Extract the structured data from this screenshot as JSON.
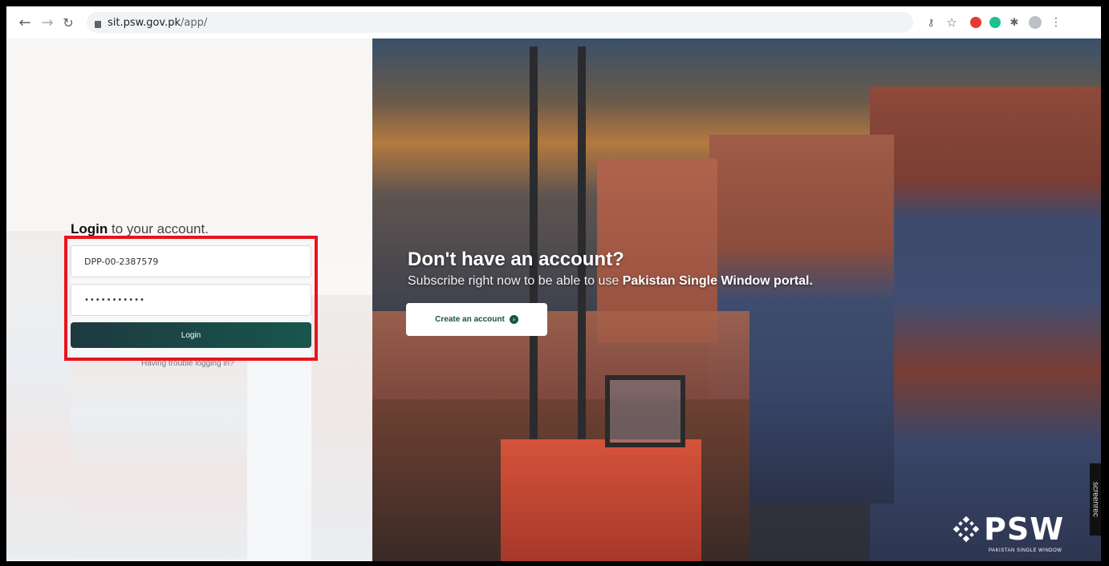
{
  "browser": {
    "url_host": "sit.psw.gov.pk",
    "url_path": "/app/",
    "icons": [
      "back-arrow-icon",
      "forward-arrow-icon",
      "reload-icon",
      "lock-icon",
      "key-icon",
      "star-icon",
      "extension-red-icon",
      "extension-green-icon",
      "puzzle-icon",
      "profile-icon",
      "menu-icon"
    ]
  },
  "login": {
    "title_bold": "Login",
    "title_rest": " to your account.",
    "username_value": "DPP-00-2387579",
    "password_value": "•••••••••••",
    "button_label": "Login",
    "trouble_text": "Having trouble logging in?"
  },
  "cta": {
    "title": "Don't have an account?",
    "subtitle_prefix": "Subscribe right now to be able to use ",
    "subtitle_bold": "Pakistan Single Window portal.",
    "button_label": "Create an account"
  },
  "brand": {
    "name": "PSW",
    "tagline": "PAKISTAN SINGLE WINDOW"
  },
  "watermark": {
    "text": "screenrec"
  },
  "colors": {
    "login_button": "#1d3a40",
    "accent_green": "#17564a",
    "highlight_red": "#e8141c"
  }
}
